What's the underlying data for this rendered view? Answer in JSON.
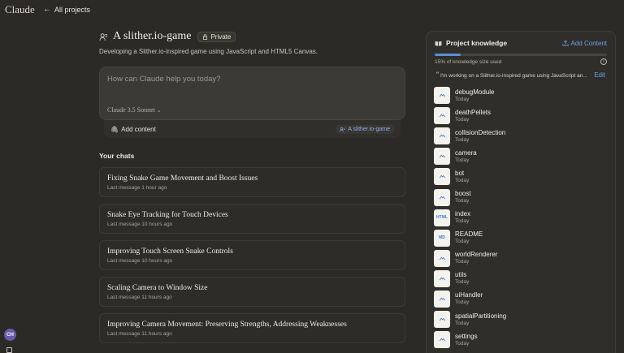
{
  "app": {
    "brand": "Claude",
    "back_label": "All projects"
  },
  "project": {
    "title": "A slither.io-game",
    "visibility": "Private",
    "description": "Developing a Slither.io-inspired game using JavaScript and HTML5 Canvas."
  },
  "prompt": {
    "placeholder": "How can Claude help you today?",
    "model": "Claude 3.5 Sonnet",
    "add_content": "Add content",
    "project_chip": "A slither.io-game"
  },
  "chats": {
    "header": "Your chats",
    "items": [
      {
        "title": "Fixing Snake Game Movement and Boost Issues",
        "meta": "Last message 1 hour ago"
      },
      {
        "title": "Snake Eye Tracking for Touch Devices",
        "meta": "Last message 10 hours ago"
      },
      {
        "title": "Improving Touch Screen Snake Controls",
        "meta": "Last message 10 hours ago"
      },
      {
        "title": "Scaling Camera to Window Size",
        "meta": "Last message 11 hours ago"
      },
      {
        "title": "Improving Camera Movement: Preserving Strengths, Addressing Weaknesses",
        "meta": "Last message 11 hours ago"
      }
    ]
  },
  "knowledge": {
    "title": "Project knowledge",
    "add_label": "Add Content",
    "usage_text": "15% of knowledge size used",
    "usage_fraction": 0.15,
    "instructions_preview": "I'm working on a Slither.io-inspired game using JavaScript an...",
    "edit_label": "Edit",
    "files": [
      {
        "name": "debugModule",
        "date": "Today",
        "kind": ""
      },
      {
        "name": "deathPellets",
        "date": "Today",
        "kind": ""
      },
      {
        "name": "collisionDetection",
        "date": "Today",
        "kind": ""
      },
      {
        "name": "camera",
        "date": "Today",
        "kind": ""
      },
      {
        "name": "bot",
        "date": "Today",
        "kind": ""
      },
      {
        "name": "boost",
        "date": "Today",
        "kind": ""
      },
      {
        "name": "index",
        "date": "Today",
        "kind": "HTML"
      },
      {
        "name": "README",
        "date": "Today",
        "kind": "MD"
      },
      {
        "name": "worldRenderer",
        "date": "Today",
        "kind": ""
      },
      {
        "name": "utils",
        "date": "Today",
        "kind": ""
      },
      {
        "name": "uiHandler",
        "date": "Today",
        "kind": ""
      },
      {
        "name": "spatialPartitioning",
        "date": "Today",
        "kind": ""
      },
      {
        "name": "settings",
        "date": "Today",
        "kind": ""
      }
    ]
  },
  "user": {
    "initials": "CH"
  },
  "colors": {
    "accent": "#6fa2e8",
    "background": "#2b2a27",
    "panel": "#2f2e2a"
  }
}
